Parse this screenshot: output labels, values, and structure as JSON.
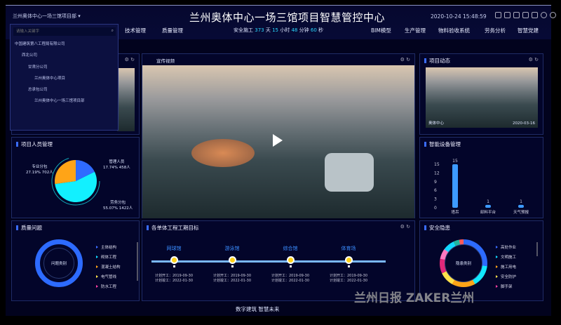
{
  "header": {
    "project_select": "兰州奥体中心一场三馆项目部 ▾",
    "title": "兰州奥体中心一场三馆项目智慧管控中心",
    "datetime": "2020-10-24 15:48:59",
    "nav_left": [
      "技术管理",
      "质量管理"
    ],
    "nav_right": [
      "BIM模型",
      "生产管理",
      "物料验收系统",
      "劳务分析",
      "智慧党建"
    ],
    "safety": {
      "label": "安全施工",
      "days": "373",
      "d": "天",
      "hours": "15",
      "h": "小时",
      "minutes": "48",
      "m": "分钟",
      "seconds": "60",
      "s": "秒"
    },
    "icons": [
      "bell-icon",
      "clock-icon",
      "calendar-icon",
      "monitor-icon",
      "shirt-icon",
      "help-icon",
      "user-icon"
    ]
  },
  "dropdown": {
    "placeholder": "请输入关键字",
    "tree": [
      "中国建筑第八工程局有限公司",
      "西北公司",
      "甘肃分公司",
      "兰州奥体中心项目",
      "总承包公司",
      "兰州奥体中心一场三馆项目部"
    ]
  },
  "video": {
    "tab": "宣传视频"
  },
  "news": {
    "title": "项目动态",
    "caption": "奥体中心",
    "date": "2020-03-16"
  },
  "staff": {
    "title": "项目人员管理",
    "slices": [
      {
        "name": "管理人员",
        "pct": "17.74%",
        "count": "458人",
        "value": 17.74,
        "color": "#2f6bff"
      },
      {
        "name": "劳务分包",
        "pct": "55.07%",
        "count": "1422人",
        "value": 55.07,
        "color": "#12f0ff"
      },
      {
        "name": "专业分包",
        "pct": "27.19%",
        "count": "702人",
        "value": 27.19,
        "color": "#ffa417"
      }
    ]
  },
  "devices": {
    "title": "智能设备管理",
    "chart_data": {
      "type": "bar",
      "categories": [
        "塔吊",
        "卸料平台",
        "天气预报"
      ],
      "values": [
        15,
        1,
        1
      ],
      "yticks": [
        "15",
        "12",
        "9",
        "6",
        "3",
        "0"
      ],
      "ylim": [
        0,
        15
      ]
    }
  },
  "quality": {
    "title": "质量问题",
    "center": "问题类别",
    "legend": [
      {
        "label": "主体结构",
        "color": "#3a6cff"
      },
      {
        "label": "砌体工程",
        "color": "#12d8ff"
      },
      {
        "label": "混凝土结构",
        "color": "#ffa417"
      },
      {
        "label": "电气管线",
        "color": "#ffe14a"
      },
      {
        "label": "防水工程",
        "color": "#ff3ea5"
      }
    ]
  },
  "schedule": {
    "title": "各单体工程工期目标",
    "items": [
      {
        "name": "网球馆",
        "start": "计划开工：2019-09-30",
        "end": "计划竣工：2022-01-30"
      },
      {
        "name": "游泳馆",
        "start": "计划开工：2019-09-30",
        "end": "计划竣工：2022-01-30"
      },
      {
        "name": "综合馆",
        "start": "计划开工：2019-09-30",
        "end": "计划竣工：2022-01-30"
      },
      {
        "name": "体育场",
        "start": "计划开工：2019-09-30",
        "end": "计划竣工：2022-01-30"
      }
    ]
  },
  "safety_risk": {
    "title": "安全隐患",
    "center": "隐患类别",
    "legend": [
      {
        "label": "高处作业",
        "color": "#3a6cff"
      },
      {
        "label": "文明施工",
        "color": "#12d8ff"
      },
      {
        "label": "施工用电",
        "color": "#ffa417"
      },
      {
        "label": "安全防护",
        "color": "#ffe14a"
      },
      {
        "label": "脚手架",
        "color": "#ff3ea5"
      }
    ]
  },
  "footer": {
    "slogan": "数字建筑 智慧未来"
  },
  "watermark": "兰州日报  ZAKER兰州"
}
